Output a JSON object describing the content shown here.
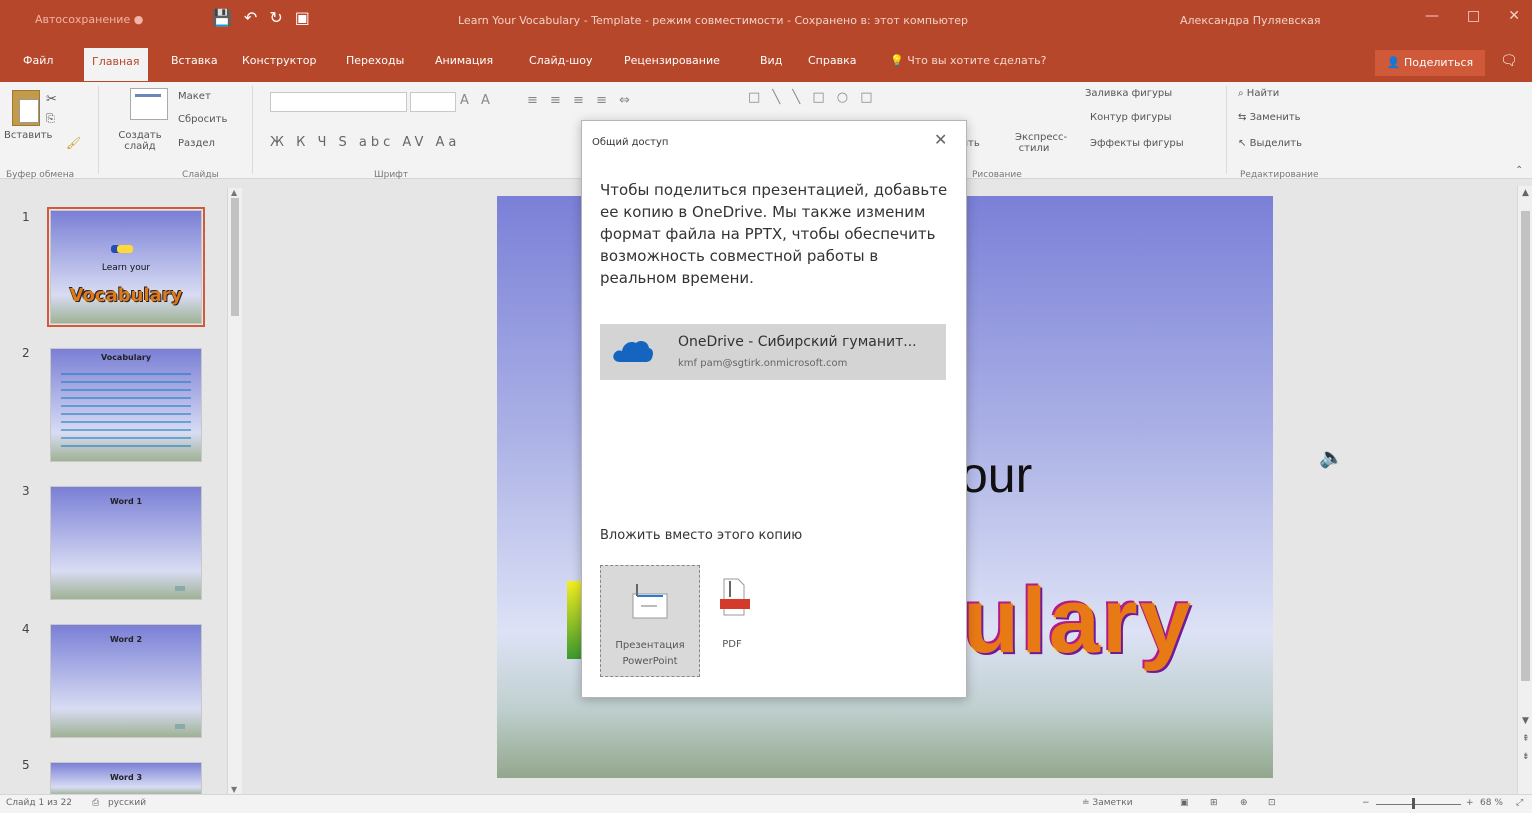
{
  "titlebar": {
    "autosave": "Автосохранение ●",
    "doc_title": "Learn Your Vocabulary - Template  -  режим совместимости  -  Сохранено в: этот компьютер",
    "user": "Александра Пуляевская",
    "min": "—",
    "max": "□",
    "close": "✕"
  },
  "tabs": [
    {
      "label": "Файл"
    },
    {
      "label": "Главная"
    },
    {
      "label": "Вставка"
    },
    {
      "label": "Конструктор"
    },
    {
      "label": "Переходы"
    },
    {
      "label": "Анимация"
    },
    {
      "label": "Слайд-шоу"
    },
    {
      "label": "Рецензирование"
    },
    {
      "label": "Вид"
    },
    {
      "label": "Справка"
    }
  ],
  "tell_me": "Что вы хотите сделать?",
  "share": "Поделиться",
  "ribbon": {
    "paste": "Вставить",
    "new_slide": "Создать слайд",
    "layout": "Макет",
    "reset": "Сбросить",
    "section": "Раздел",
    "group_clipboard": "Буфер обмена",
    "group_slides": "Слайды",
    "group_font": "Шрифт",
    "group_drawing": "Рисование",
    "group_editing": "Редактирование",
    "shape_fill": "Заливка фигуры",
    "shape_outline": "Контур фигуры",
    "shape_effects": "Эффекты фигуры",
    "arrange_partial": "...очить",
    "quick_styles": "Экспресс-стили",
    "find": "Найти",
    "replace": "Заменить",
    "select": "Выделить"
  },
  "thumbnails": [
    {
      "num": "1",
      "title": "",
      "sub1": "Learn your",
      "sub2": "Vocabulary"
    },
    {
      "num": "2",
      "title": "Vocabulary",
      "sub1": "",
      "sub2": ""
    },
    {
      "num": "3",
      "title": "Word 1",
      "sub1": "",
      "sub2": ""
    },
    {
      "num": "4",
      "title": "Word 2",
      "sub1": "",
      "sub2": ""
    },
    {
      "num": "5",
      "title": "Word 3",
      "sub1": "",
      "sub2": ""
    }
  ],
  "slide": {
    "title1_visible": "our",
    "title2_visible": "ulary"
  },
  "dialog": {
    "title": "Общий доступ",
    "close": "✕",
    "description": "Чтобы поделиться презентацией, добавьте ее копию в OneDrive. Мы также изменим формат файла на PPTX, чтобы обеспечить возможность совместной работы в реальном времени.",
    "onedrive_title": "OneDrive - Сибирский гуманит...",
    "onedrive_email": "kmf pam@sgtirk.onmicrosoft.com",
    "embed_heading": "Вложить вместо этого копию",
    "option_pptx": "Презентация PowerPoint",
    "option_pdf": "PDF"
  },
  "status": {
    "slide_info": "Слайд 1 из 22",
    "language": "русский",
    "notes": "Заметки",
    "zoom": "68 %"
  },
  "colors": {
    "accent": "#b7472a",
    "ribbon_bg": "#f3f3f3"
  }
}
